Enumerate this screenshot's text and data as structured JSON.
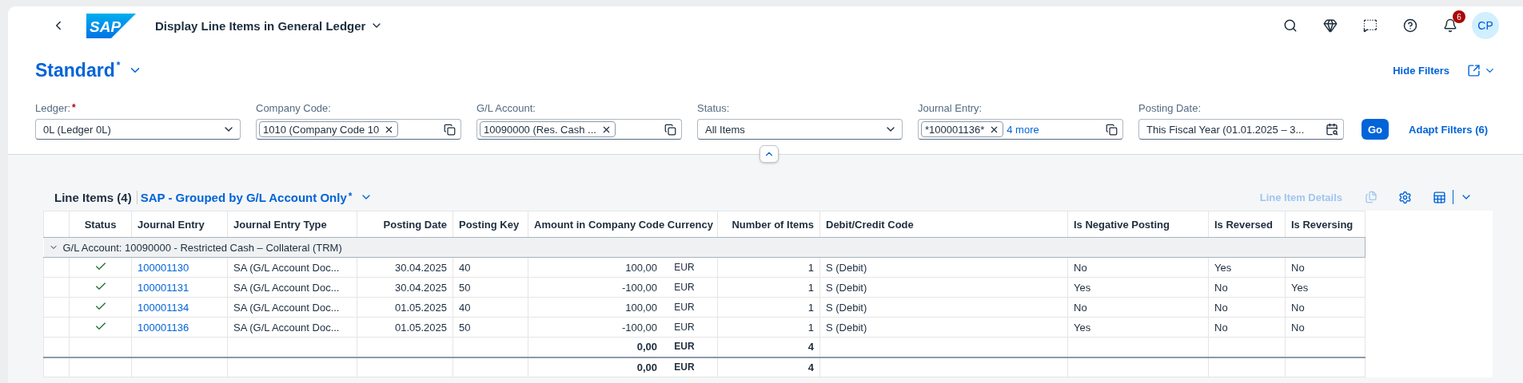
{
  "shell": {
    "logo": "SAP",
    "title": "Display Line Items in General Ledger",
    "notifications": "6",
    "avatar": "CP"
  },
  "header": {
    "variant": "Standard",
    "modified_mark": "*",
    "hide_filters": "Hide Filters"
  },
  "filters": [
    {
      "kind": "select",
      "label": "Ledger:",
      "required_mark": "*",
      "value": "0L (Ledger 0L)"
    },
    {
      "kind": "tokens",
      "label": "Company Code:",
      "tokens": [
        "1010 (Company Code 10"
      ]
    },
    {
      "kind": "tokens",
      "label": "G/L Account:",
      "tokens": [
        "10090000 (Res. Cash ..."
      ]
    },
    {
      "kind": "select",
      "label": "Status:",
      "value": "All Items"
    },
    {
      "kind": "tokens",
      "label": "Journal Entry:",
      "tokens": [
        "*100001136*"
      ],
      "more": "4 more"
    },
    {
      "kind": "date",
      "label": "Posting Date:",
      "value": "This Fiscal Year (01.01.2025 – 3..."
    }
  ],
  "filter_actions": {
    "go": "Go",
    "adapt": "Adapt Filters (6)"
  },
  "table": {
    "title": "Line Items (4)",
    "variant": "SAP - Grouped by G/L Account Only",
    "modified_mark": "*",
    "details": {
      "label": "Line Item Details",
      "disabled": true
    },
    "columns": [
      {
        "label": "Status"
      },
      {
        "label": "Journal Entry"
      },
      {
        "label": "Journal Entry Type"
      },
      {
        "label": "Posting Date"
      },
      {
        "label": "Posting Key"
      },
      {
        "label": "Amount in Company Code Currency"
      },
      {
        "label": "Number of Items"
      },
      {
        "label": "Debit/Credit Code"
      },
      {
        "label": "Is Negative Posting"
      },
      {
        "label": "Is Reversed"
      },
      {
        "label": "Is Reversing"
      }
    ],
    "group": {
      "label": "G/L Account: 10090000 - Restricted Cash – Collateral (TRM)",
      "expanded": true
    },
    "rows": [
      {
        "status_ok": true,
        "entry": "100001130",
        "type": "SA (G/L Account Doc...",
        "date": "30.04.2025",
        "key": "40",
        "amount": "100,00",
        "currency": "EUR",
        "count": "1",
        "dc": "S (Debit)",
        "negative": "No",
        "reversed": "Yes",
        "reversing": "No"
      },
      {
        "status_ok": true,
        "entry": "100001131",
        "type": "SA (G/L Account Doc...",
        "date": "30.04.2025",
        "key": "50",
        "amount": "-100,00",
        "currency": "EUR",
        "count": "1",
        "dc": "S (Debit)",
        "negative": "Yes",
        "reversed": "No",
        "reversing": "Yes"
      },
      {
        "status_ok": true,
        "entry": "100001134",
        "type": "SA (G/L Account Doc...",
        "date": "01.05.2025",
        "key": "40",
        "amount": "100,00",
        "currency": "EUR",
        "count": "1",
        "dc": "S (Debit)",
        "negative": "No",
        "reversed": "No",
        "reversing": "No"
      },
      {
        "status_ok": true,
        "entry": "100001136",
        "type": "SA (G/L Account Doc...",
        "date": "01.05.2025",
        "key": "50",
        "amount": "-100,00",
        "currency": "EUR",
        "count": "1",
        "dc": "S (Debit)",
        "negative": "Yes",
        "reversed": "No",
        "reversing": "No"
      }
    ],
    "totals": [
      {
        "kind": "subtotal",
        "amount": "0,00",
        "currency": "EUR",
        "count": "4"
      },
      {
        "kind": "total",
        "amount": "0,00",
        "currency": "EUR",
        "count": "4"
      }
    ]
  }
}
